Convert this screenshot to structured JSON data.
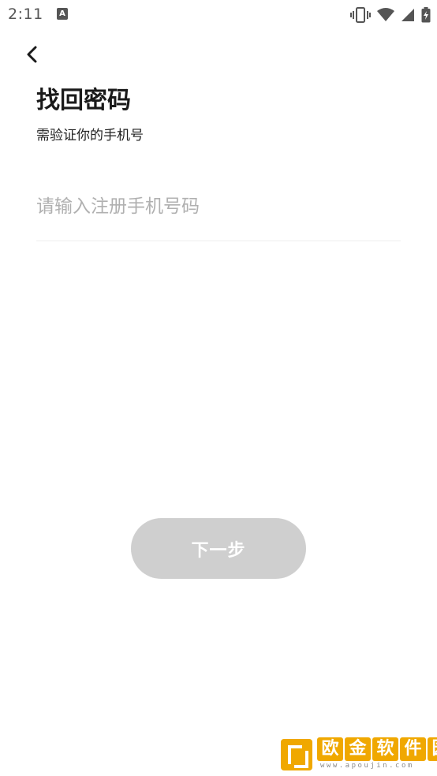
{
  "status_bar": {
    "time": "2:11",
    "notification_icon_letter": "A",
    "icons": [
      "vibrate-icon",
      "wifi-icon",
      "signal-icon",
      "battery-charging-icon"
    ]
  },
  "header": {
    "back_icon": "chevron-left-icon",
    "title": "找回密码",
    "subtitle": "需验证你的手机号"
  },
  "form": {
    "phone_placeholder": "请输入注册手机号码",
    "phone_value": ""
  },
  "actions": {
    "next_label": "下一步"
  },
  "watermark": {
    "chars": [
      "欧",
      "金",
      "软",
      "件",
      "园"
    ],
    "url": "www.apoujin.com"
  },
  "colors": {
    "button_disabled": "#cfcfcf",
    "placeholder": "#b0b0b0",
    "divider": "#eeeeee",
    "watermark": "#f0a800"
  }
}
